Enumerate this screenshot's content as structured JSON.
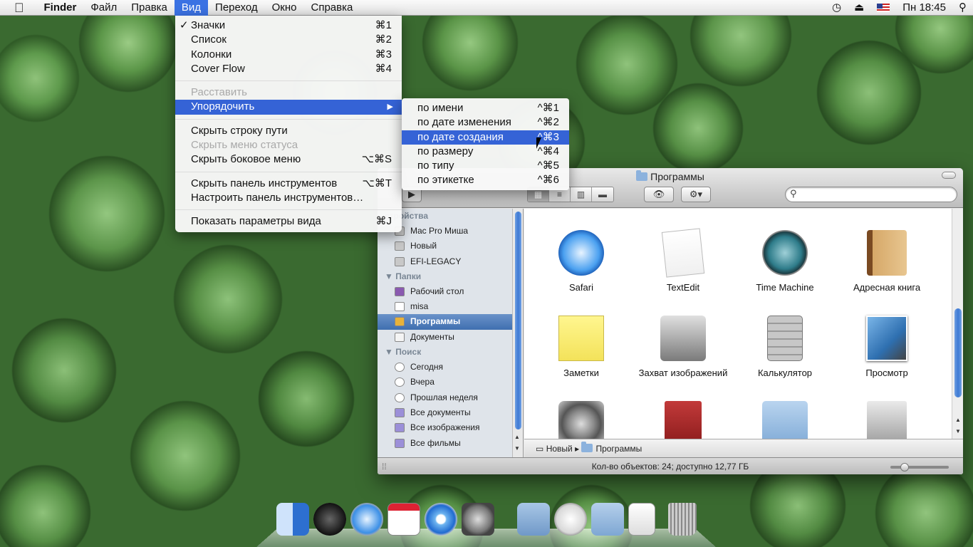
{
  "menubar": {
    "apple": "",
    "app": "Finder",
    "menus": [
      "Файл",
      "Правка",
      "Вид",
      "Переход",
      "Окно",
      "Справка"
    ],
    "clock": "Пн 18:45"
  },
  "view_menu": {
    "items": [
      {
        "label": "Значки",
        "shortcut": "⌘1",
        "checked": "✓"
      },
      {
        "label": "Список",
        "shortcut": "⌘2"
      },
      {
        "label": "Колонки",
        "shortcut": "⌘3"
      },
      {
        "label": "Cover Flow",
        "shortcut": "⌘4"
      },
      {
        "label": "Расставить",
        "shortcut": ""
      },
      {
        "label": "Упорядочить",
        "shortcut": "",
        "arrow": "▶"
      },
      {
        "label": "Скрыть строку пути",
        "shortcut": ""
      },
      {
        "label": "Скрыть меню статуса",
        "shortcut": ""
      },
      {
        "label": "Скрыть боковое меню",
        "shortcut": "⌥⌘S"
      },
      {
        "label": "Скрыть панель инструментов",
        "shortcut": "⌥⌘T"
      },
      {
        "label": "Настроить панель инструментов…",
        "shortcut": ""
      },
      {
        "label": "Показать параметры вида",
        "shortcut": "⌘J"
      }
    ]
  },
  "sort_menu": {
    "items": [
      {
        "label": "по имени",
        "shortcut": "^⌘1"
      },
      {
        "label": "по дате изменения",
        "shortcut": "^⌘2"
      },
      {
        "label": "по дате создания",
        "shortcut": "^⌘3"
      },
      {
        "label": "по размеру",
        "shortcut": "^⌘4"
      },
      {
        "label": "по типу",
        "shortcut": "^⌘5"
      },
      {
        "label": "по этикетке",
        "shortcut": "^⌘6"
      }
    ]
  },
  "finder": {
    "title": "Программы",
    "sidebar": {
      "devices_header": "стройства",
      "devices": [
        "Mac Pro Миша",
        "Новый",
        "EFI-LEGACY"
      ],
      "places_header": "Папки",
      "places": [
        "Рабочий стол",
        "misa",
        "Программы",
        "Документы"
      ],
      "search_header": "Поиск",
      "search": [
        "Сегодня",
        "Вчера",
        "Прошлая неделя",
        "Все документы",
        "Все изображения",
        "Все фильмы"
      ]
    },
    "apps": [
      "Safari",
      "TextEdit",
      "Time Machine",
      "Адресная книга",
      "Заметки",
      "Захват изображений",
      "Калькулятор",
      "Просмотр"
    ],
    "path": [
      "Новый",
      "Программы"
    ],
    "path_sep": "▸",
    "status": "Кол-во объектов: 24; доступно 12,77 ГБ"
  },
  "colors": {
    "highlight": "#3563d6",
    "menubar_open": "#3b72e3"
  }
}
